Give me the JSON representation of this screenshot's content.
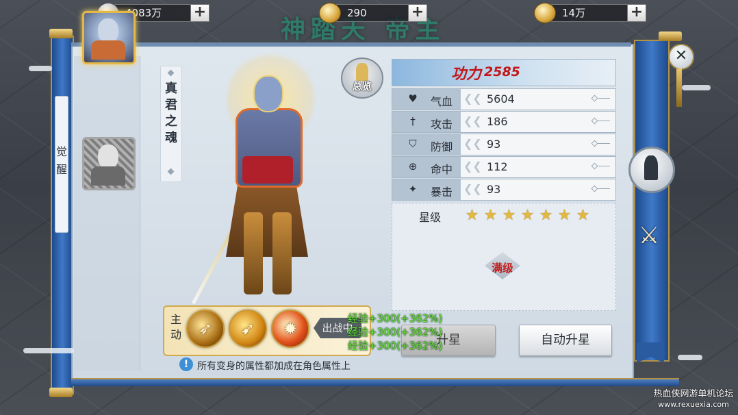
{
  "currencies": [
    {
      "amount": "4083万",
      "icon": "silver-coin-icon"
    },
    {
      "amount": "290",
      "icon": "gold-ingot-icon"
    },
    {
      "amount": "14万",
      "icon": "gold-ingot-icon"
    }
  ],
  "plus_symbol": "+",
  "background_banner": "神踏天 帝主",
  "side_tab": {
    "chars": [
      "觉",
      "醒"
    ]
  },
  "name_column": {
    "chars": [
      "真",
      "君",
      "之",
      "魂"
    ]
  },
  "overview_label": "总览",
  "power": {
    "label": "功力",
    "value": "2585"
  },
  "stats": [
    {
      "icon": "heart-icon",
      "glyph": "♥",
      "name": "气血",
      "value": "5604"
    },
    {
      "icon": "sword-icon",
      "glyph": "†",
      "name": "攻击",
      "value": "186"
    },
    {
      "icon": "shield-icon",
      "glyph": "⛉",
      "name": "防御",
      "value": "93"
    },
    {
      "icon": "crosshair-icon",
      "glyph": "⊕",
      "name": "命中",
      "value": "112"
    },
    {
      "icon": "flame-icon",
      "glyph": "✦",
      "name": "暴击",
      "value": "93"
    }
  ],
  "star_level": {
    "label": "星级",
    "stars": 7,
    "max_stars": 7
  },
  "max_level_label": "满级",
  "buttons": {
    "star_up": "升星",
    "auto_star_up": "自动升星"
  },
  "skills": {
    "tag": "主动",
    "battle_label": "出战中"
  },
  "exp_gains": [
    "经验+300(+362%)",
    "经验+300(+362%)",
    "经验+300(+362%)"
  ],
  "tip": {
    "icon_glyph": "!",
    "text": "所有变身的属性都加成在角色属性上"
  },
  "close_glyph": "✕",
  "swords_glyph": "⚔",
  "watermark": {
    "line1": "热血侠网游单机论坛",
    "line2": "www.rexuexia.com"
  },
  "colors": {
    "power_red": "#c2161a",
    "exp_green": "#69e13a",
    "star_gold": "#e2b840",
    "scroll_blue": "#2a5aa0"
  }
}
